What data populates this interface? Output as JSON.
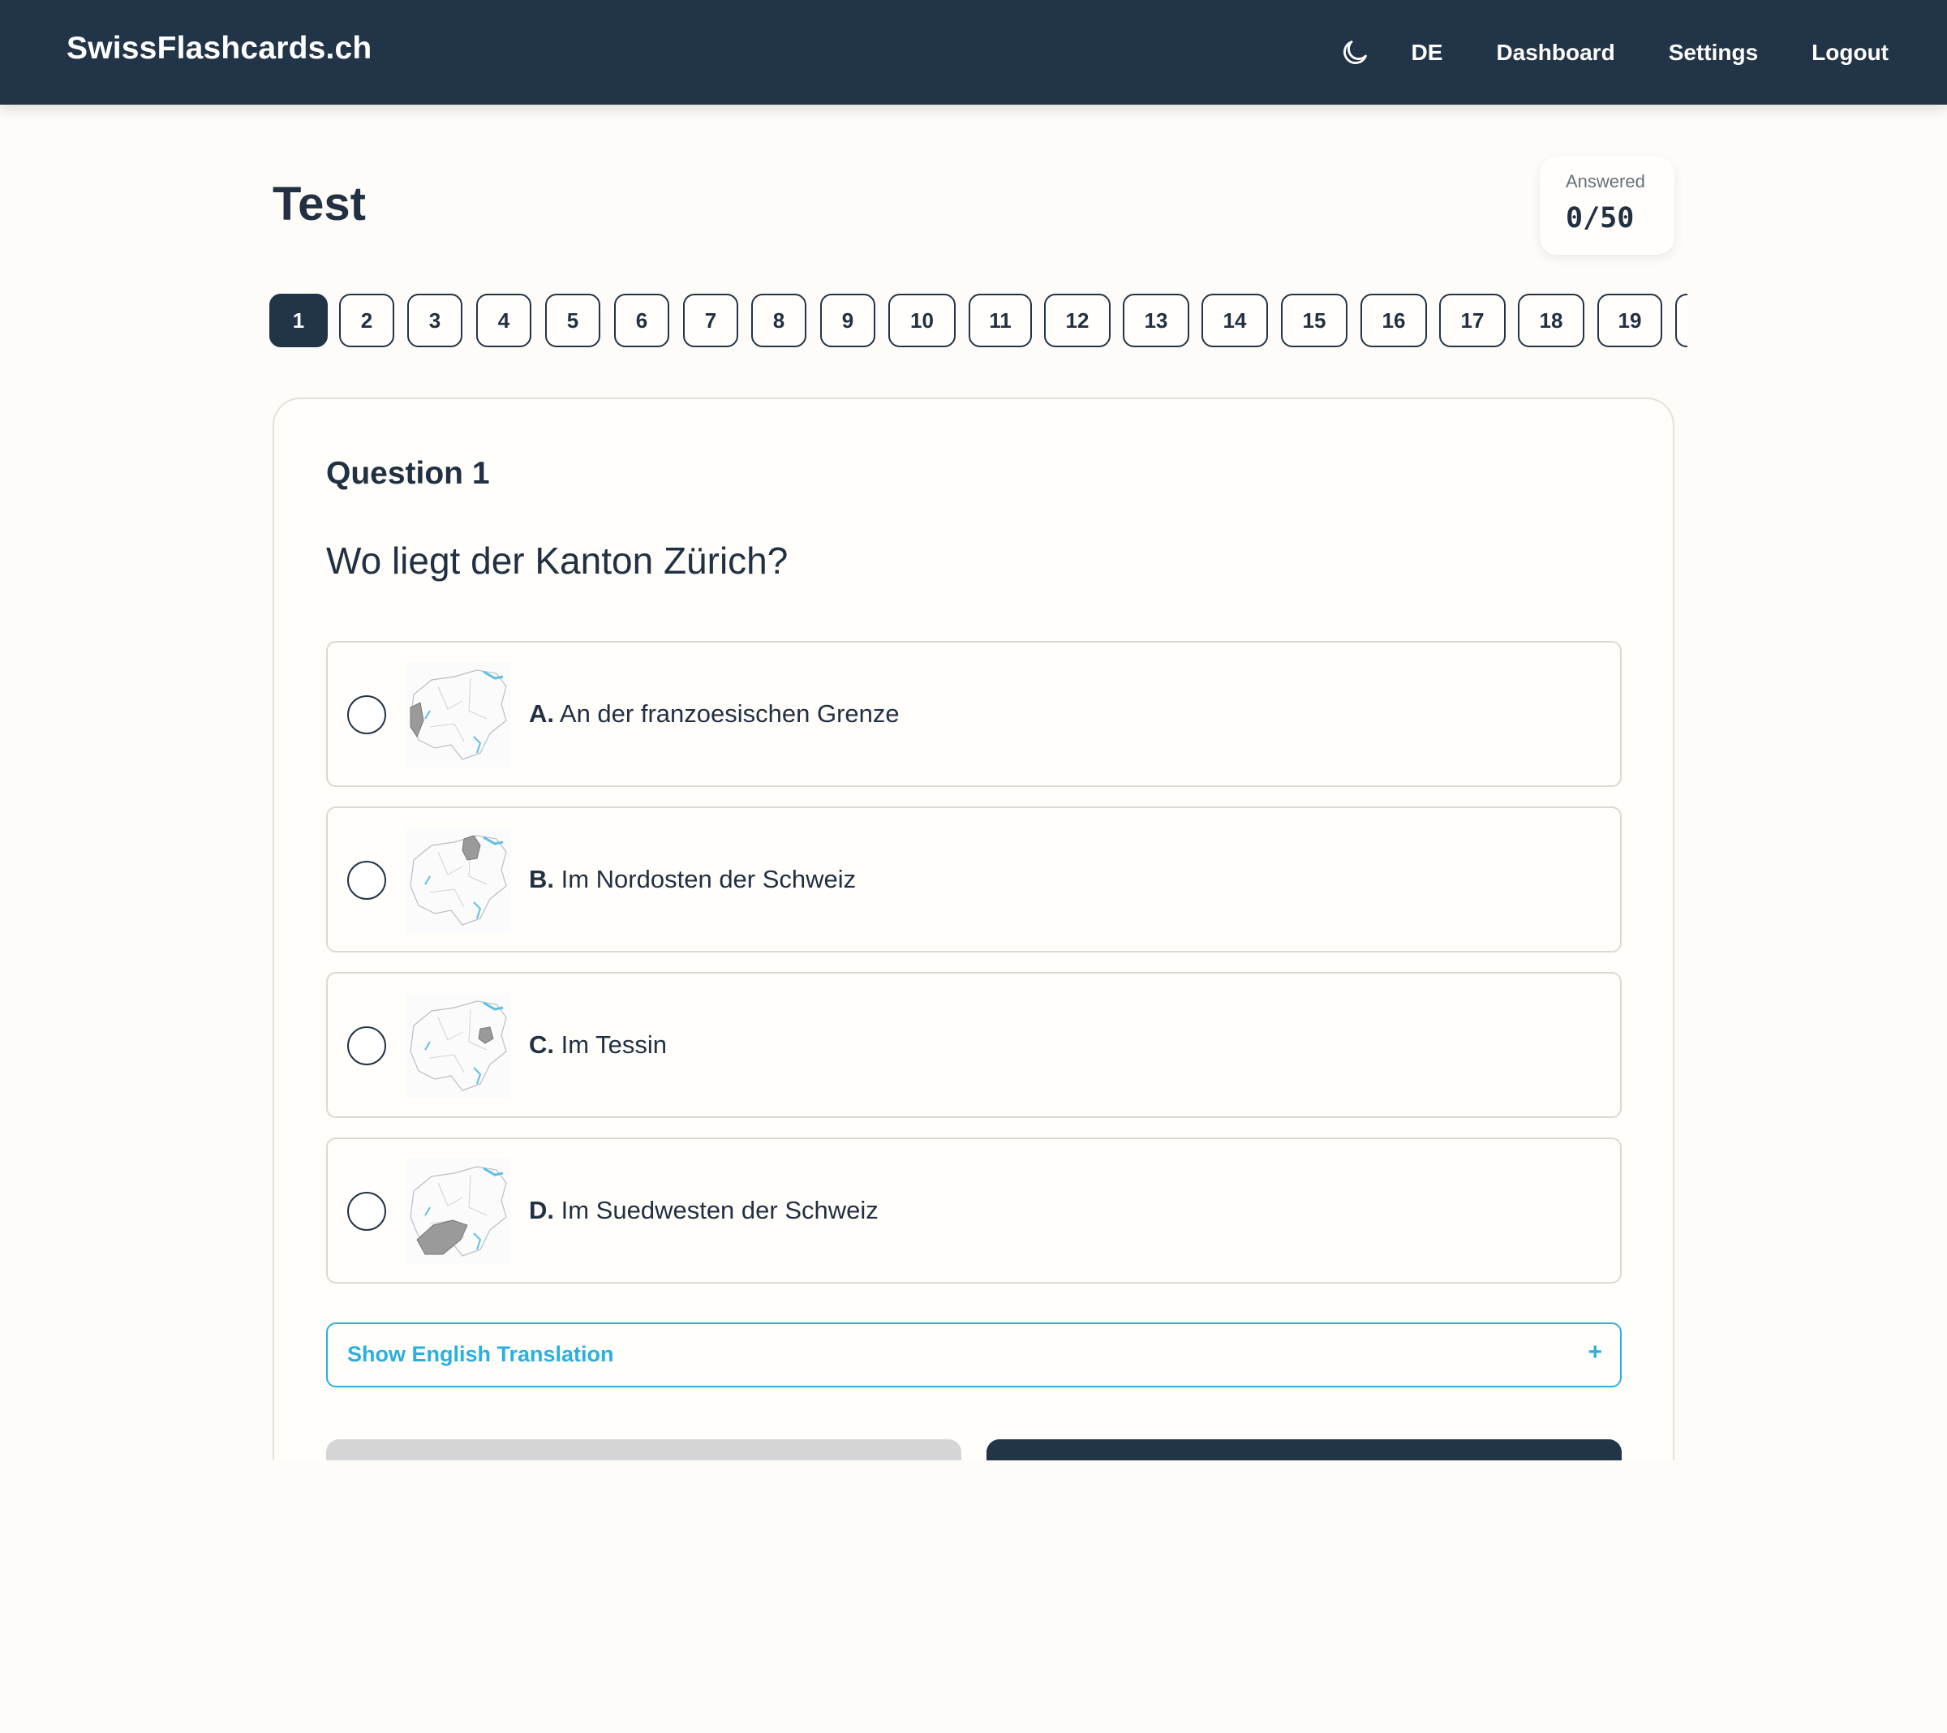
{
  "navbar": {
    "brand": "SwissFlashcards.ch",
    "theme_icon": "moon-icon",
    "language": "DE",
    "links": [
      "Dashboard",
      "Settings",
      "Logout"
    ]
  },
  "page": {
    "title": "Test",
    "answered_label": "Answered",
    "answered_value": "0/50"
  },
  "question_nav": {
    "active": "1",
    "numbers": [
      "1",
      "2",
      "3",
      "4",
      "5",
      "6",
      "7",
      "8",
      "9",
      "10",
      "11",
      "12",
      "13",
      "14",
      "15",
      "16",
      "17",
      "18",
      "19"
    ]
  },
  "question": {
    "number_label": "Question 1",
    "text": "Wo liegt der Kanton Zürich?",
    "options": [
      {
        "letter": "A.",
        "text": "An der franzoesischen Grenze",
        "image": "switzerland-map-west-highlight-icon"
      },
      {
        "letter": "B.",
        "text": "Im Nordosten der Schweiz",
        "image": "switzerland-map-northeast-highlight-icon"
      },
      {
        "letter": "C.",
        "text": "Im Tessin",
        "image": "switzerland-map-central-highlight-icon"
      },
      {
        "letter": "D.",
        "text": "Im Suedwesten der Schweiz",
        "image": "switzerland-map-southwest-highlight-icon"
      }
    ],
    "translation_toggle": "Show English Translation",
    "translation_toggle_icon": "+"
  },
  "colors": {
    "navy": "#223447",
    "accent": "#2ab0e0",
    "background": "#fefcf8"
  }
}
